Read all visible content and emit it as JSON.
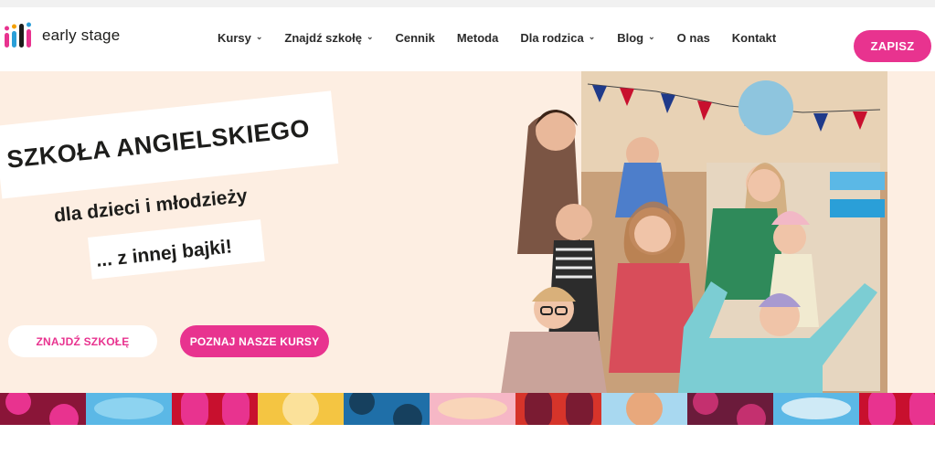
{
  "brand": {
    "name": "early stage"
  },
  "nav": {
    "items": [
      {
        "label": "Kursy",
        "dropdown": true
      },
      {
        "label": "Znajdź szkołę",
        "dropdown": true
      },
      {
        "label": "Cennik",
        "dropdown": false
      },
      {
        "label": "Metoda",
        "dropdown": false
      },
      {
        "label": "Dla rodzica",
        "dropdown": true
      },
      {
        "label": "Blog",
        "dropdown": true
      },
      {
        "label": "O nas",
        "dropdown": false
      },
      {
        "label": "Kontakt",
        "dropdown": false
      }
    ],
    "cta_label": "ZAPISZ"
  },
  "hero": {
    "title": "SZKOŁA ANGIELSKIEGO",
    "subtitle": "dla dzieci i młodzieży",
    "tagline": "... z innej bajki!",
    "button_find": "ZNAJDŹ SZKOŁĘ",
    "button_courses": "POZNAJ NASZE KURSY"
  },
  "colors": {
    "accent": "#e8338f",
    "hero_bg": "#fdeee2",
    "text": "#1d1d1b"
  },
  "icons": [
    "logo-mark-icon",
    "chevron-down-icon"
  ],
  "pattern_tiles": [
    {
      "bg": "#8a1538",
      "fg": "#e8338f"
    },
    {
      "bg": "#5bb8e6",
      "fg": "#8dd3f0"
    },
    {
      "bg": "#c8102e",
      "fg": "#e8338f"
    },
    {
      "bg": "#f4c542",
      "fg": "#fbe19a"
    },
    {
      "bg": "#1f6fa8",
      "fg": "#16405e"
    },
    {
      "bg": "#f6b7c6",
      "fg": "#f9d5b9"
    },
    {
      "bg": "#d6342a",
      "fg": "#7a1b32"
    },
    {
      "bg": "#a8d8f0",
      "fg": "#e8a87c"
    },
    {
      "bg": "#6b1b3b",
      "fg": "#c4306f"
    },
    {
      "bg": "#5bb8e6",
      "fg": "#cfeaf6"
    },
    {
      "bg": "#c8102e",
      "fg": "#e8338f"
    }
  ]
}
